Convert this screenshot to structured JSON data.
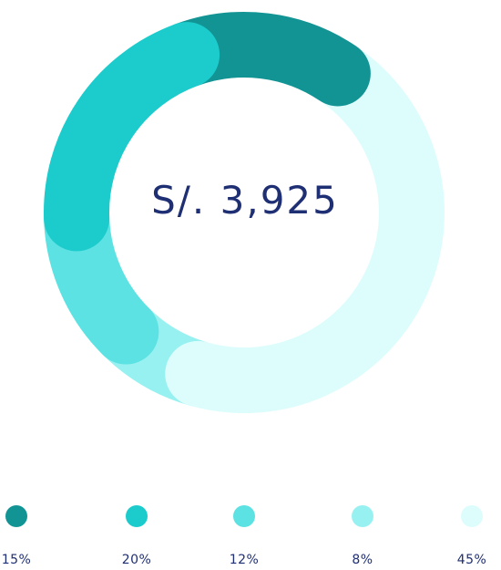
{
  "chart_data": {
    "type": "pie",
    "subtype": "donut",
    "center_label": "S/. 3,925",
    "segments": [
      {
        "label": "20%",
        "value": 20,
        "color": "#1ccccc"
      },
      {
        "label": "15%",
        "value": 15,
        "color": "#139494"
      },
      {
        "label": "45%",
        "value": 45,
        "color": "#ddfdfd"
      },
      {
        "label": "8%",
        "value": 8,
        "color": "#98f1f1"
      },
      {
        "label": "12%",
        "value": 12,
        "color": "#5ce2e2"
      }
    ],
    "legend": [
      {
        "label": "15%",
        "color": "#139494"
      },
      {
        "label": "20%",
        "color": "#1ccccc"
      },
      {
        "label": "12%",
        "color": "#5ce2e2"
      },
      {
        "label": "8%",
        "color": "#98f1f1"
      },
      {
        "label": "45%",
        "color": "#ddfdfd"
      }
    ]
  }
}
